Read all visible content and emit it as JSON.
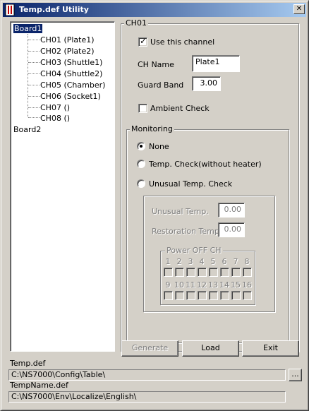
{
  "window": {
    "title": "Temp.def Utility",
    "close_glyph": "✕"
  },
  "tree": {
    "boards": [
      {
        "label": "Board1",
        "selected": true,
        "channels": [
          "CH01 (Plate1)",
          "CH02 (Plate2)",
          "CH03 (Shuttle1)",
          "CH04 (Shuttle2)",
          "CH05 (Chamber)",
          "CH06 (Socket1)",
          "CH07 ()",
          "CH08 ()"
        ]
      },
      {
        "label": "Board2",
        "selected": false,
        "channels": []
      }
    ]
  },
  "channel_group": {
    "label": "CH01",
    "use_channel": {
      "label": "Use this channel",
      "checked": true
    },
    "ch_name": {
      "label": "CH Name",
      "value": "Plate1"
    },
    "guard_band": {
      "label": "Guard Band",
      "value": "3.00"
    },
    "ambient_check": {
      "label": "Ambient Check",
      "checked": false
    }
  },
  "monitoring": {
    "label": "Monitoring",
    "options": [
      {
        "label": "None",
        "selected": true
      },
      {
        "label": "Temp. Check(without heater)",
        "selected": false
      },
      {
        "label": "Unusual Temp. Check",
        "selected": false
      }
    ],
    "unusual_temp": {
      "label": "Unusual Temp.",
      "value": "0.00"
    },
    "restoration_temp": {
      "label": "Restoration Temp.",
      "value": "0.00"
    },
    "power_off": {
      "label": "Power OFF CH",
      "row1": [
        "1",
        "2",
        "3",
        "4",
        "5",
        "6",
        "7",
        "8"
      ],
      "row2": [
        "9",
        "10",
        "11",
        "12",
        "13",
        "14",
        "15",
        "16"
      ]
    }
  },
  "buttons": {
    "generate": "Generate",
    "load": "Load",
    "exit": "Exit"
  },
  "paths": {
    "temp_def_label": "Temp.def",
    "temp_def_path": "C:\\NS7000\\Config\\Table\\",
    "browse_label": "...",
    "tempname_def_label": "TempName.def",
    "tempname_def_path": "C:\\NS7000\\Env\\Localize\\English\\"
  }
}
